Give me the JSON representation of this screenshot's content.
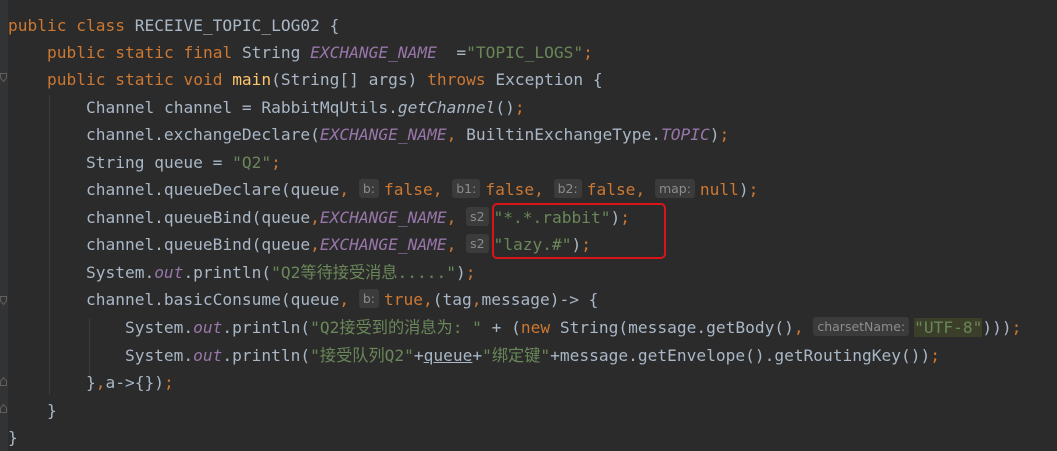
{
  "lines": [
    "public class RECEIVE_TOPIC_LOG02 {",
    "public static final String EXCHANGE_NAME  =\"TOPIC_LOGS\";",
    "public static void main(String[] args) throws Exception {",
    "Channel channel = RabbitMqUtils.getChannel();",
    "channel.exchangeDeclare(EXCHANGE_NAME, BuiltinExchangeType.TOPIC);",
    "String queue = \"Q2\";",
    "channel.queueDeclare(queue, b: false, b1: false, b2: false, map: null);",
    "channel.queueBind(queue,EXCHANGE_NAME, s2: \"*.*.rabbit\");",
    "channel.queueBind(queue,EXCHANGE_NAME, s2: \"lazy.#\");",
    "System.out.println(\"Q2等待接受消息.....\");",
    "channel.basicConsume(queue, b: true,(tag,message)-> {",
    "System.out.println(\"Q2接受到的消息为: \" + (new String(message.getBody(), charsetName: \"UTF-8\")));",
    "System.out.println(\"接受队列Q2\"+queue+\"绑定键\"+message.getEnvelope().getRoutingKey());",
    "},a->{});",
    "}",
    "}"
  ],
  "tokens": {
    "public": "public",
    "class": "class",
    "static": "static",
    "final": "final",
    "void": "void",
    "throws": "throws",
    "new": "new",
    "null": "null",
    "false": "false",
    "true": "true",
    "class_name": "RECEIVE_TOPIC_LOG02",
    "String": "String",
    "Exception": "Exception",
    "Channel": "Channel",
    "EXCHANGE_NAME": "EXCHANGE_NAME",
    "TOPIC": "TOPIC",
    "out": "out",
    "getChannel": "getChannel",
    "main": "main",
    "str_topic_logs": "\"TOPIC_LOGS\"",
    "str_q2": "\"Q2\"",
    "str_rabbit": "\"*.*.rabbit\"",
    "str_lazy": "\"lazy.#\"",
    "str_wait": "\"Q2等待接受消息.....\"",
    "str_received": "\"Q2接受到的消息为: \"",
    "str_utf8": "\"UTF-8\"",
    "str_queue_q2": "\"接受队列Q2\"",
    "str_bindkey": "\"绑定键\"",
    "queue_var": "queue"
  },
  "hints": {
    "b": "b:",
    "b1": "b1:",
    "b2": "b2:",
    "map": "map:",
    "s2": "s2",
    "charsetName": "charsetName:"
  },
  "colors": {
    "background": "#2b2b2b",
    "keyword": "#cc7832",
    "constant": "#9876aa",
    "method_decl": "#ffc66d",
    "string": "#6a8759",
    "text": "#a9b7c6",
    "annotation_box": "#d9151a"
  }
}
